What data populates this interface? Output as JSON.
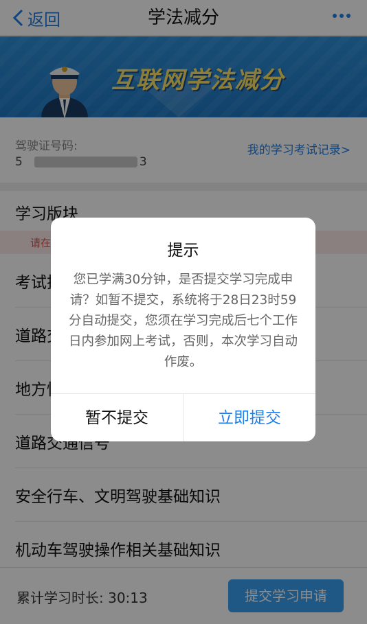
{
  "nav": {
    "back_label": "返回",
    "title": "学法减分"
  },
  "banner": {
    "title": "互联网学法减分"
  },
  "driver": {
    "license_label": "驾驶证号码:",
    "license_value_start": "5",
    "license_value_end": "3",
    "records_link": "我的学习考试记录>"
  },
  "study": {
    "section_title": "学习版块",
    "notice": "请在",
    "items": [
      {
        "label": "考试技"
      },
      {
        "label": "道路交"
      },
      {
        "label": "地方性"
      },
      {
        "label": "道路交通信号"
      },
      {
        "label": "安全行车、文明驾驶基础知识"
      },
      {
        "label": "机动车驾驶操作相关基础知识"
      }
    ]
  },
  "bottom": {
    "duration_label": "累计学习时长:  30:13",
    "submit_label": "提交学习申请"
  },
  "dialog": {
    "title": "提示",
    "message": "您已学满30分钟，是否提交学习完成申请？如暂不提交，系统将于28日23时59分自动提交，您须在学习完成后七个工作日内参加网上考试，否则，本次学习自动作废。",
    "cancel_label": "暂不提交",
    "confirm_label": "立即提交"
  },
  "colors": {
    "accent": "#1f7fe6",
    "button_blue": "#3aa1f0",
    "banner_blue": "#2c8fd8",
    "banner_text": "#ffe566"
  }
}
